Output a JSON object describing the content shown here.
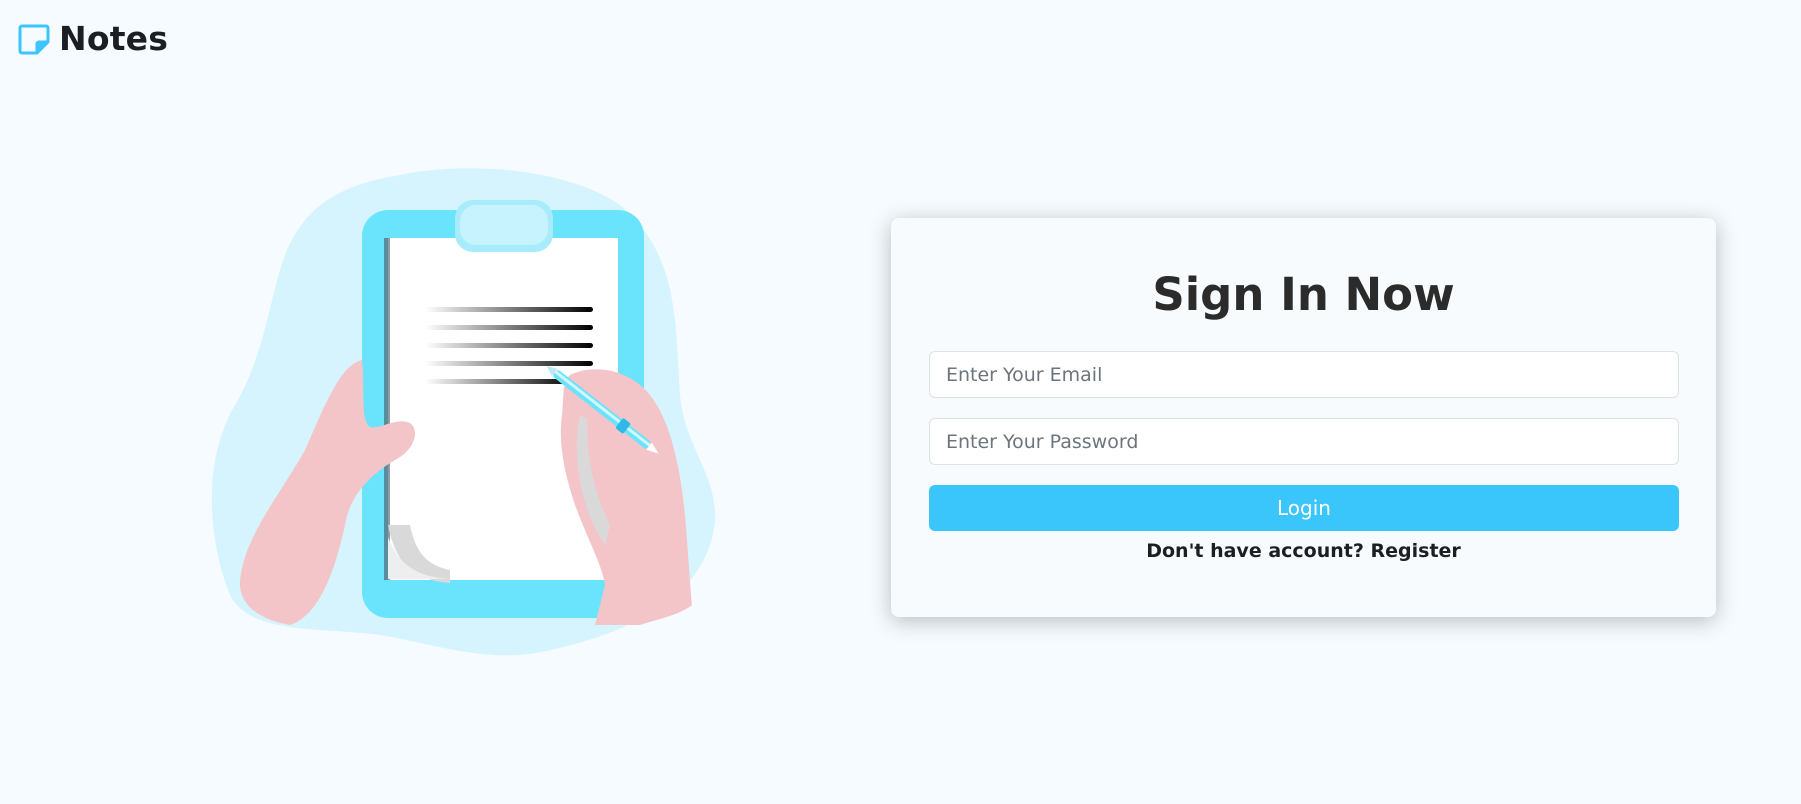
{
  "brand": {
    "title": "Notes",
    "icon": "sticky-note-icon",
    "icon_color": "#3ac5fb"
  },
  "illustration": {
    "icon": "clipboard-writing-illustration",
    "colors": {
      "blob": "#d6f4fd",
      "clipboard": "#6ae3fd",
      "paper": "#ffffff",
      "skin": "#f4c5c8"
    }
  },
  "login": {
    "title": "Sign In Now",
    "email_placeholder": "Enter Your Email",
    "password_placeholder": "Enter Your Password",
    "email_value": "",
    "password_value": "",
    "button_label": "Login",
    "register_prompt": "Don't have account?",
    "register_link": "Register"
  },
  "colors": {
    "accent": "#3ac5fb",
    "background": "#f5fbff",
    "card": "#f8fbfd"
  }
}
